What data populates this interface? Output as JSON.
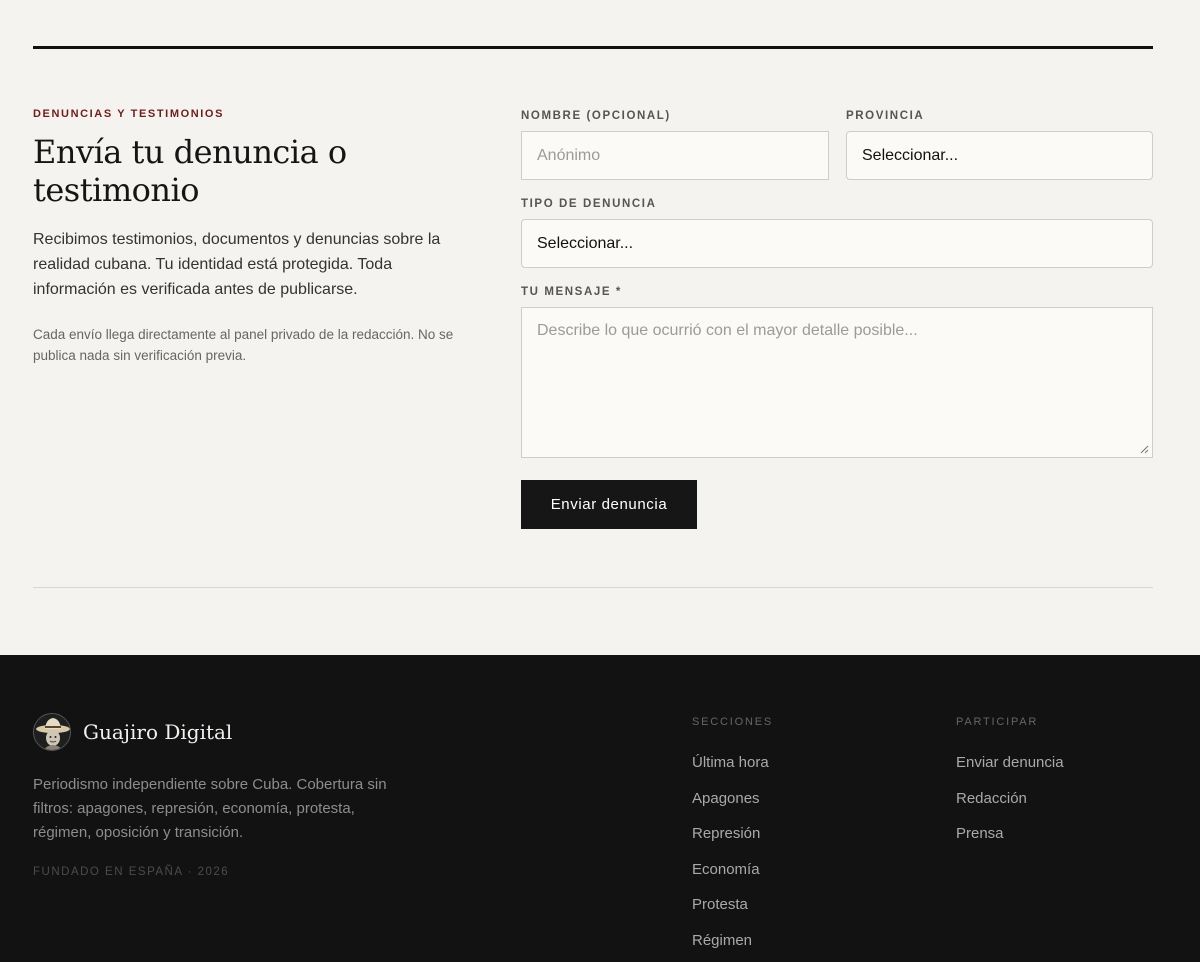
{
  "section": {
    "eyebrow": "DENUNCIAS Y TESTIMONIOS",
    "title": "Envía tu denuncia o testimonio",
    "lede": "Recibimos testimonios, documentos y denuncias sobre la realidad cubana. Tu identidad está protegida. Toda información es verificada antes de publicarse.",
    "note": "Cada envío llega directamente al panel privado de la redacción. No se publica nada sin verificación previa."
  },
  "form": {
    "name_label": "NOMBRE (OPCIONAL)",
    "name_placeholder": "Anónimo",
    "name_value": "",
    "province_label": "PROVINCIA",
    "province_selected": "Seleccionar...",
    "type_label": "TIPO DE DENUNCIA",
    "type_selected": "Seleccionar...",
    "message_label": "TU MENSAJE *",
    "message_placeholder": "Describe lo que ocurrió con el mayor detalle posible...",
    "message_value": "",
    "submit_label": "Enviar denuncia"
  },
  "footer": {
    "brand_name": "Guajiro Digital",
    "logo_icon": "guajiro-hat-portrait-icon",
    "description": "Periodismo independiente sobre Cuba. Cobertura sin filtros: apagones, represión, economía, protesta, régimen, oposición y transición.",
    "founded": "FUNDADO EN ESPAÑA · 2026",
    "sections_heading": "SECCIONES",
    "sections": [
      "Última hora",
      "Apagones",
      "Represión",
      "Economía",
      "Protesta",
      "Régimen"
    ],
    "participate_heading": "PARTICIPAR",
    "participate": [
      "Enviar denuncia",
      "Redacción",
      "Prensa"
    ]
  },
  "colors": {
    "page_background": "#f4f3ef",
    "footer_background": "#121212",
    "eyebrow_accent": "#6e1d1d",
    "button_background": "#161616"
  }
}
